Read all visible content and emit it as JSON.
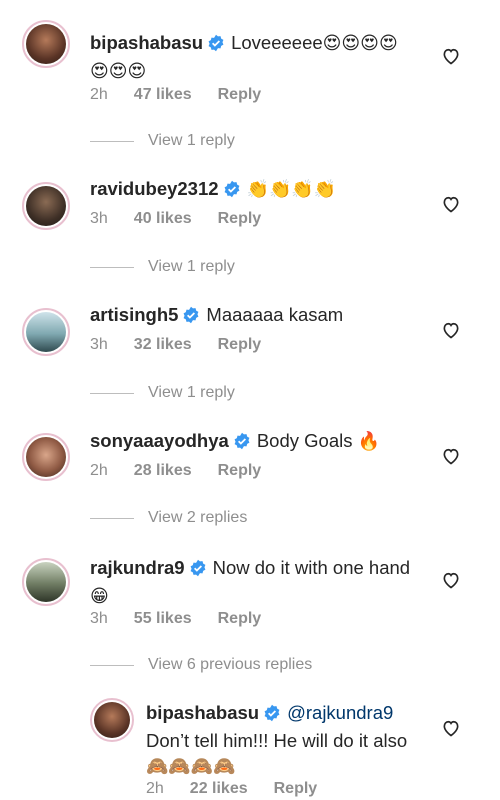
{
  "comments": [
    {
      "username": "bipashabasu",
      "verified": true,
      "text": "Loveeeeee",
      "emoji_line1": "😍😍😍😍",
      "emoji_line2": "😍😍😍",
      "time": "2h",
      "likes": "47 likes",
      "reply": "Reply",
      "view_replies": "View 1 reply"
    },
    {
      "username": "ravidubey2312",
      "verified": true,
      "emoji_line1": "👏👏👏👏",
      "time": "3h",
      "likes": "40 likes",
      "reply": "Reply",
      "view_replies": "View 1 reply"
    },
    {
      "username": "artisingh5",
      "verified": true,
      "text": "Maaaaaa kasam",
      "time": "3h",
      "likes": "32 likes",
      "reply": "Reply",
      "view_replies": "View 1 reply"
    },
    {
      "username": "sonyaaayodhya",
      "verified": true,
      "text": "Body Goals",
      "emoji_line1": "🔥",
      "time": "2h",
      "likes": "28 likes",
      "reply": "Reply",
      "view_replies": "View 2 replies"
    },
    {
      "username": "rajkundra9",
      "verified": true,
      "text": "Now do it with one hand",
      "emoji_line2": "😁",
      "time": "3h",
      "likes": "55 likes",
      "reply": "Reply",
      "view_replies": "View 6 previous replies"
    },
    {
      "username": "bipashabasu",
      "verified": true,
      "mention": "@rajkundra9",
      "text_line2": "Don’t tell him!!! He will do it also",
      "emoji_line3": "🙈🙈🙈🙈",
      "time": "2h",
      "likes": "22 likes",
      "reply": "Reply"
    }
  ],
  "colors": {
    "username": "#262626",
    "meta": "#8e8e8e",
    "verified": "#3897f0",
    "mention": "#00376b"
  },
  "icons": {
    "verified": "verified-badge-icon",
    "like": "heart-outline-icon"
  }
}
